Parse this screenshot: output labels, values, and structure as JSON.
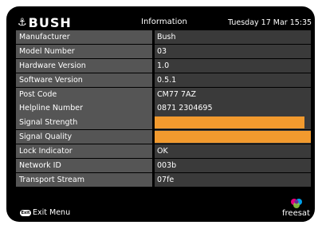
{
  "header": {
    "brand": "BUSH",
    "title": "Information",
    "datetime": "Tuesday 17 Mar 15:35"
  },
  "rows": [
    {
      "label": "Manufacturer",
      "value": "Bush"
    },
    {
      "label": "Model Number",
      "value": "03"
    },
    {
      "label": "Hardware Version",
      "value": "1.0"
    },
    {
      "label": "Software Version",
      "value": "0.5.1"
    },
    {
      "label": "Post Code",
      "value": "CM77 7AZ"
    },
    {
      "label": "Helpline Number",
      "value": "0871 2304695"
    },
    {
      "label": "Signal Strength",
      "value": "",
      "level_percent": 96
    },
    {
      "label": "Signal Quality",
      "value": "",
      "level_percent": 100
    },
    {
      "label": "Lock Indicator",
      "value": "OK"
    },
    {
      "label": "Network ID",
      "value": "003b"
    },
    {
      "label": "Transport Stream",
      "value": "07fe"
    }
  ],
  "footer": {
    "exit_button": "Exit",
    "exit_label": "Exit Menu",
    "brand_logo": "freesat"
  },
  "colors": {
    "background": "#000000",
    "label_bg": "#555555",
    "value_bg": "#3a3a3a",
    "signal_bar": "#f29a2e"
  }
}
